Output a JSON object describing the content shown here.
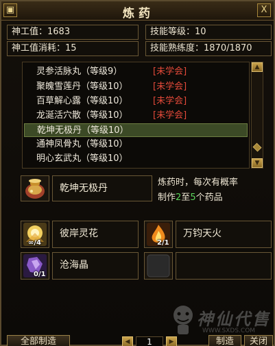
{
  "window": {
    "title": "炼药",
    "left_button": "▣",
    "close_button": "X"
  },
  "stats": {
    "shengong_value": "神工值：1683",
    "skill_level": "技能等级：10",
    "shengong_cost": "神工值消耗：15",
    "skill_proficiency": "技能熟练度：1870/1870"
  },
  "recipes": [
    {
      "name": "灵参活脉丸（等级9）",
      "status": "[未学会]"
    },
    {
      "name": "聚魄雪莲丹（等级10）",
      "status": "[未学会]"
    },
    {
      "name": "百草解心露（等级10）",
      "status": "[未学会]"
    },
    {
      "name": "龙涎活穴散（等级10）",
      "status": "[未学会]"
    },
    {
      "name": "乾坤无极丹（等级10）",
      "status": ""
    },
    {
      "name": "通神凤骨丸（等级10）",
      "status": ""
    },
    {
      "name": "明心玄武丸（等级10）",
      "status": ""
    }
  ],
  "selected_index": 4,
  "product": {
    "name": "乾坤无极丹",
    "icon": "potion-jar-icon"
  },
  "description": {
    "line1": "炼药时，每次有概率",
    "line2_a": "制作",
    "num_a": "2",
    "line2_b": "至",
    "num_b": "5",
    "line2_c": "个药品"
  },
  "materials": [
    {
      "name": "彼岸灵花",
      "count": "∞/4",
      "icon": "flower-icon"
    },
    {
      "name": "万钧天火",
      "count": "2/1",
      "icon": "fire-icon"
    },
    {
      "name": "沧海晶",
      "count": "0/1",
      "icon": "crystal-icon"
    },
    {
      "name": "",
      "count": "",
      "icon": "empty-slot-icon"
    }
  ],
  "controls": {
    "make_all": "全部制造",
    "page": "1",
    "make": "制造",
    "close": "关闭"
  },
  "watermark": {
    "text": "神仙代售",
    "url": "WWW.SXDS.COM"
  },
  "colors": {
    "unlearned": "#e54a3a",
    "highlight": "#5cd65c",
    "selected_row": "#3c4a26"
  }
}
